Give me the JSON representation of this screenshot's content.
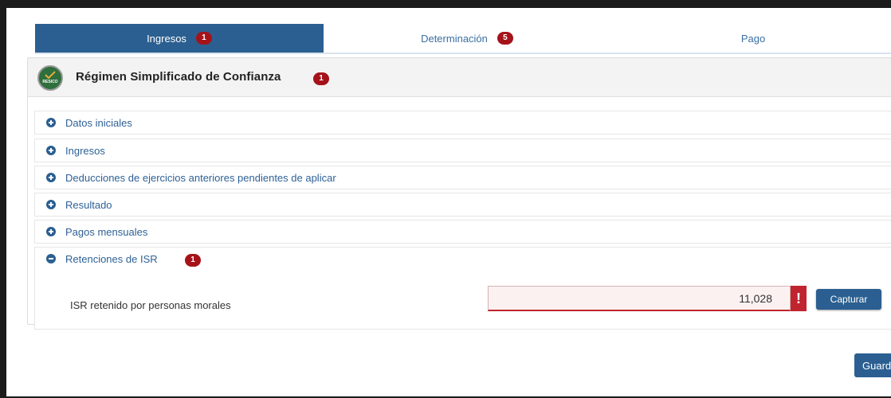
{
  "tabs": [
    {
      "label": "Ingresos",
      "badge": "1",
      "active": true
    },
    {
      "label": "Determinación",
      "badge": "5",
      "active": false
    },
    {
      "label": "Pago",
      "badge": "",
      "active": false
    }
  ],
  "panel": {
    "logo_text": "RESICO",
    "title": "Régimen Simplificado de Confianza",
    "badge": "1"
  },
  "sections": [
    {
      "label": "Datos iniciales",
      "icon": "plus-circle-icon"
    },
    {
      "label": "Ingresos",
      "icon": "plus-circle-icon"
    },
    {
      "label": "Deducciones de ejercicios anteriores pendientes de aplicar",
      "icon": "plus-circle-icon"
    },
    {
      "label": "Resultado",
      "icon": "plus-circle-icon"
    },
    {
      "label": "Pagos mensuales",
      "icon": "plus-circle-icon"
    },
    {
      "label": "Retenciones de ISR",
      "icon": "minus-circle-icon",
      "badge": "1"
    }
  ],
  "field": {
    "label": "ISR retenido por personas morales",
    "value": "11,028",
    "error_mark": "!"
  },
  "buttons": {
    "capture": "Capturar",
    "save": "Guardar"
  },
  "colors": {
    "primary": "#2b5f91",
    "badge": "#a5121a",
    "error": "#c0242e"
  }
}
